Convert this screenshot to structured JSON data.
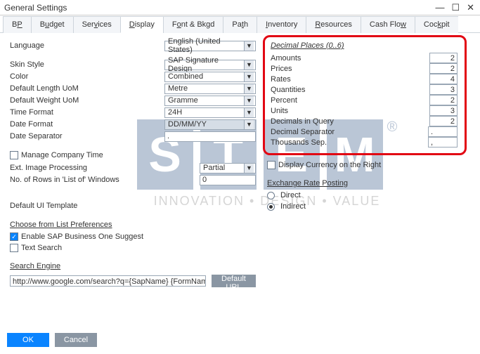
{
  "window": {
    "title": "General Settings"
  },
  "tabs": {
    "bp": "BP",
    "budget": "Budget",
    "services": "Services",
    "display": "Display",
    "font": "Font & Bkgd",
    "path": "Path",
    "inventory": "Inventory",
    "resources": "Resources",
    "cashflow": "Cash Flow",
    "cockpit": "Cockpit"
  },
  "left": {
    "language_lbl": "Language",
    "language_val": "English (United States)",
    "skin_lbl": "Skin Style",
    "skin_val": "SAP Signature Design",
    "color_lbl": "Color",
    "color_val": "Combined",
    "deflen_lbl": "Default Length UoM",
    "deflen_val": "Metre",
    "defwt_lbl": "Default Weight UoM",
    "defwt_val": "Gramme",
    "timefmt_lbl": "Time Format",
    "timefmt_val": "24H",
    "datefmt_lbl": "Date Format",
    "datefmt_val": "DD/MM/YY",
    "datesep_lbl": "Date Separator",
    "datesep_val": ".",
    "mct_lbl": "Manage Company Time",
    "extimg_lbl": "Ext. Image Processing",
    "extimg_val": "Partial",
    "rows_lbl": "No. of Rows in 'List of' Windows",
    "rows_val": "0",
    "defui_lbl": "Default UI Template",
    "clp_lbl": "Choose from List Preferences",
    "suggest_lbl": "Enable SAP Business One Suggest",
    "tsearch_lbl": "Text Search",
    "seng_lbl": "Search Engine",
    "seng_val": "http://www.google.com/search?q={SapName} {FormName} {MessageString} site:sap.com",
    "defurl_btn": "Default URL"
  },
  "decimal": {
    "header": "Decimal Places (0..6)",
    "amounts_lbl": "Amounts",
    "amounts_val": "2",
    "prices_lbl": "Prices",
    "prices_val": "2",
    "rates_lbl": "Rates",
    "rates_val": "4",
    "qty_lbl": "Quantities",
    "qty_val": "3",
    "pct_lbl": "Percent",
    "pct_val": "2",
    "units_lbl": "Units",
    "units_val": "3",
    "dq_lbl": "Decimals in Query",
    "dq_val": "2",
    "dsep_lbl": "Decimal Separator",
    "dsep_val": ".",
    "tsep_lbl": "Thousands Sep.",
    "tsep_val": ","
  },
  "right": {
    "dispcurr_lbl": "Display Currency on the Right",
    "erp_lbl": "Exchange Rate Posting",
    "direct_lbl": "Direct",
    "indirect_lbl": "Indirect"
  },
  "footer": {
    "ok": "OK",
    "cancel": "Cancel"
  },
  "watermark": {
    "s": "S",
    "t": "T",
    "e": "E",
    "m": "M",
    "tag": "INNOVATION • DESIGN • VALUE"
  }
}
